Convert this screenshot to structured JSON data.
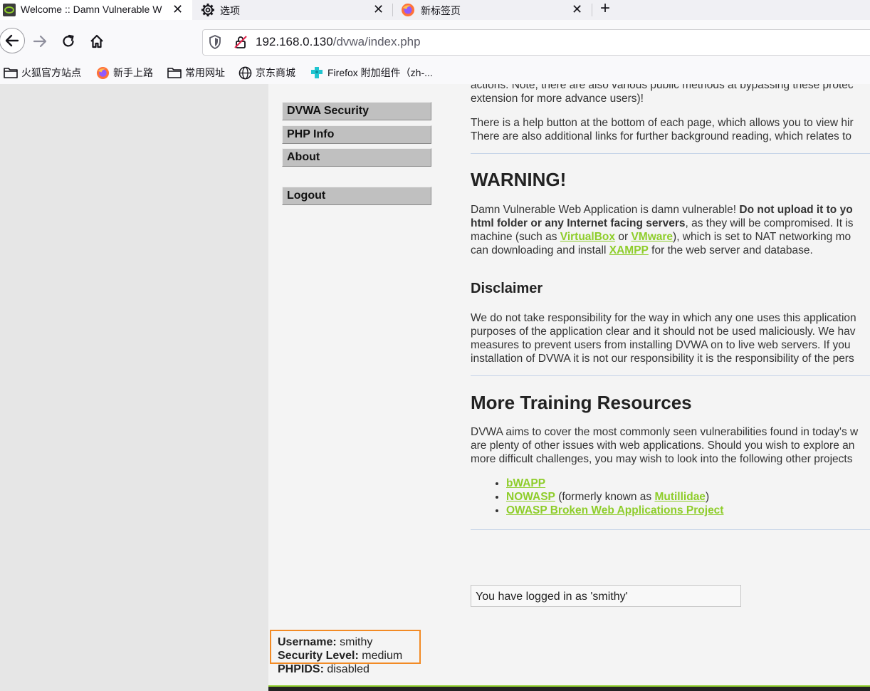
{
  "browser": {
    "tabs": [
      {
        "title": "Welcome :: Damn Vulnerable W",
        "active": true,
        "icon": "dvwa-favicon-icon"
      },
      {
        "title": "选项",
        "active": false,
        "icon": "gear-icon"
      },
      {
        "title": "新标签页",
        "active": false,
        "icon": "firefox-icon"
      }
    ],
    "close_glyph": "✕",
    "new_tab_glyph": "+",
    "url_host": "192.168.0.130",
    "url_path": "/dvwa/index.php",
    "bookmarks": [
      {
        "label": "火狐官方站点",
        "icon": "folder-icon"
      },
      {
        "label": "新手上路",
        "icon": "firefox-icon"
      },
      {
        "label": "常用网址",
        "icon": "folder-icon"
      },
      {
        "label": "京东商城",
        "icon": "globe-icon"
      },
      {
        "label": "Firefox 附加组件（zh-...",
        "icon": "puzzle-icon"
      }
    ]
  },
  "menu": {
    "items": [
      "DVWA Security",
      "PHP Info",
      "About"
    ],
    "logout": "Logout"
  },
  "content": {
    "intro_line1": "actions. Note, there are also various public methods at bypassing these protec",
    "intro_line2": "extension for more advance users)!",
    "help_line1": "There is a help button at the bottom of each page, which allows you to view hir",
    "help_line2": "There are also additional links for further background reading, which relates to",
    "warning_title": "WARNING!",
    "warn_l1_a": "Damn Vulnerable Web Application is damn vulnerable! ",
    "warn_l1_b": "Do not upload it to yo",
    "warn_l2_a": "html folder or any Internet facing servers",
    "warn_l2_b": ", as they will be compromised. It is",
    "warn_l3_a": "machine (such as ",
    "warn_l3_link1": "VirtualBox",
    "warn_l3_or": " or ",
    "warn_l3_link2": "VMware",
    "warn_l3_b": "), which is set to NAT networking mo",
    "warn_l4_a": "can downloading and install ",
    "warn_l4_link": "XAMPP",
    "warn_l4_b": " for the web server and database.",
    "disclaimer_title": "Disclaimer",
    "disc_l1": "We do not take responsibility for the way in which any one uses this application",
    "disc_l2": "purposes of the application clear and it should not be used maliciously. We hav",
    "disc_l3": "measures to prevent users from installing DVWA on to live web servers. If you",
    "disc_l4": "installation of DVWA it is not our responsibility it is the responsibility of the pers",
    "more_title": "More Training Resources",
    "more_l1": "DVWA aims to cover the most commonly seen vulnerabilities found in today's w",
    "more_l2": "are plenty of other issues with web applications. Should you wish to explore an",
    "more_l3": "more difficult challenges, you may wish to look into the following other projects",
    "res1": "bWAPP",
    "res2": "NOWASP",
    "res2_mid": " (formerly known as ",
    "res2_link": "Mutillidae",
    "res2_end": ")",
    "res3": "OWASP Broken Web Applications Project",
    "logged_in": "You have logged in as 'smithy'"
  },
  "user": {
    "username_label": "Username:",
    "username": " smithy",
    "security_label": "Security Level:",
    "security": " medium",
    "phpids_label": "PHPIDS:",
    "phpids": " disabled"
  }
}
